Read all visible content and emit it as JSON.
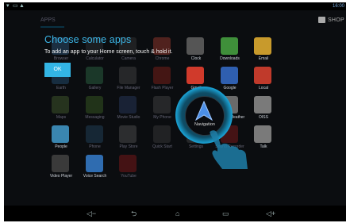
{
  "status_bar": {
    "left_icons": [
      "notification-icon",
      "image-icon",
      "warning-icon"
    ],
    "right_icons": [
      "battery-icon",
      "clock-icon"
    ],
    "time": "16:00"
  },
  "header": {
    "apps_tab_label": "APPS",
    "shop_label": "SHOP"
  },
  "cling": {
    "title": "Choose some apps",
    "text": "To add an app to your Home screen, touch & hold it.",
    "ok_label": "OK"
  },
  "apps": [
    {
      "name": "Browser",
      "color": "#3a6fa0"
    },
    {
      "name": "Calculator",
      "color": "#3a3f46"
    },
    {
      "name": "Camera",
      "color": "#444"
    },
    {
      "name": "Chrome",
      "color": "#d24a3a"
    },
    {
      "name": "Clock",
      "color": "#555"
    },
    {
      "name": "Downloads",
      "color": "#3f8f3a"
    },
    {
      "name": "Email",
      "color": "#c89a2c"
    },
    {
      "name": "Earth",
      "color": "#2d6a9a"
    },
    {
      "name": "Gallery",
      "color": "#3a8a58"
    },
    {
      "name": "File Manager",
      "color": "#5a5a5a"
    },
    {
      "name": "Flash Player",
      "color": "#b0281e"
    },
    {
      "name": "Gmail",
      "color": "#d03a2b"
    },
    {
      "name": "Google",
      "color": "#2f5fb0"
    },
    {
      "name": "Local",
      "color": "#c03a2b"
    },
    {
      "name": "Maps",
      "color": "#5a7a3a"
    },
    {
      "name": "Messaging",
      "color": "#4a7a2a"
    },
    {
      "name": "Movie Studio",
      "color": "#334a7a"
    },
    {
      "name": "My Phone",
      "color": "#5a5a5a"
    },
    {
      "name": "Navigation",
      "color": "#1a1a1a"
    },
    {
      "name": "News & Weather",
      "color": "#6a6a6a"
    },
    {
      "name": "OISS",
      "color": "#7a7a7a"
    },
    {
      "name": "People",
      "color": "#3a86b0"
    },
    {
      "name": "Phone",
      "color": "#2a5a7a"
    },
    {
      "name": "Play Store",
      "color": "#6a6a6a"
    },
    {
      "name": "Quick Start",
      "color": "#4a4a4a"
    },
    {
      "name": "Settings",
      "color": "#5a5a5a"
    },
    {
      "name": "Sound Recorder",
      "color": "#b02020"
    },
    {
      "name": "Talk",
      "color": "#7a7a7a"
    },
    {
      "name": "Video Player",
      "color": "#3a3a3a"
    },
    {
      "name": "Voice Search",
      "color": "#2f6cb0"
    },
    {
      "name": "YouTube",
      "color": "#b01e1e"
    }
  ],
  "navigation": {
    "label": "Navigation"
  },
  "nav_bar": {
    "icons": [
      "volume-down-icon",
      "back-icon",
      "home-icon",
      "recent-apps-icon",
      "volume-up-icon"
    ]
  }
}
